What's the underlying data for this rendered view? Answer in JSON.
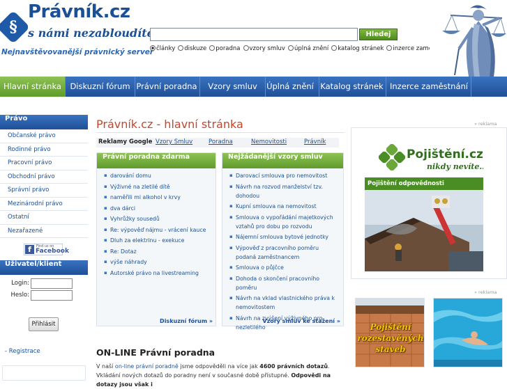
{
  "header": {
    "logo_letter": "§",
    "site_name": "Právník.cz",
    "motto": "s námi nezabloudíte...",
    "subtitle": "Nejnavštěvovanější právnický server"
  },
  "search": {
    "value": "",
    "button_label": "Hledej",
    "options": [
      "články",
      "diskuze",
      "poradna",
      "vzory smluv",
      "úplná znění",
      "katalog stránek",
      "inzerce zaměstnání"
    ],
    "selected": "články"
  },
  "nav": {
    "tabs": [
      "Hlavní stránka",
      "Diskuzní fórum",
      "Právní poradna",
      "Vzory smluv",
      "Úplná znění",
      "Katalog stránek",
      "Inzerce zaměstnání"
    ],
    "active": "Hlavní stránka"
  },
  "sidebar": {
    "law_heading": "Právo",
    "law_items": [
      "Občanské právo",
      "Rodinné právo",
      "Pracovní právo",
      "Obchodní právo",
      "Správní právo",
      "Mezinárodní právo",
      "Ostatní",
      "Nezařazené"
    ],
    "facebook_small": "Find us on",
    "facebook_big": "Facebook",
    "login_heading": "Uživatel/klient",
    "login_label": "Login:",
    "password_label": "Heslo:",
    "login_button": "Přihlásit",
    "register_link": "Registrace"
  },
  "main": {
    "title": "Právník.cz - hlavní stránka",
    "ads_label": "Reklamy Google",
    "ad_links": [
      "Vzory Smluv",
      "Poradna",
      "Nemovitosti",
      "Právník"
    ],
    "left_column": {
      "heading": "Právní poradna zdarma",
      "items": [
        "darování domu",
        "Výživné na zletilé dítě",
        "naměřili mi alkohol v krvy",
        "dva dárci",
        "Vyhrůžky sousedů",
        "Re: výpověď nájmu - vrácení kauce",
        "Dluh za elektrinu - exekuce",
        "Re: Dotaz",
        "výše náhrady",
        "Autorské právo na livestreaming"
      ],
      "more": "Diskuzní fórum »"
    },
    "right_column": {
      "heading": "Nejžádanější vzory smluv",
      "items": [
        "Darovací smlouva pro nemovitost",
        "Návrh na rozvod manželství tzv. dohodou",
        "Kupní smlouva na nemovitost",
        "Smlouva o vypořádání majetkových vztahů pro dobu po rozvodu",
        "Nájemní smlouva bytové jednotky",
        "Výpověď z pracovního poměru podaná zaměstnancem",
        "Smlouva o půjčce",
        "Dohoda o skončení pracovního poměru",
        "Návrh na vklad vlastnického práva k nemovitostem",
        "Návrh na zvýšení výživného pro nezletilého"
      ],
      "more": "Vzory smluv ke stažení »"
    },
    "online_heading": "ON-LINE Právní poradna",
    "online_text": {
      "p1": "V naší ",
      "link": "on-line právní poradně",
      "p2": " jsme odpověděli na více jak ",
      "count": "4600 právních dotazů",
      "p3": ". Vkládání nových dotazů do poradny není v současné době přístupné. ",
      "bold_end": "Odpovědi na dotazy jsou však i"
    }
  },
  "right": {
    "ad_label_top": "« reklama",
    "ad_title": "Pojištění.cz",
    "ad_tagline": "nikdy nevíte...",
    "ad_strip": "Pojištění odpovědnosti",
    "ad_label_bottom": "« reklama",
    "house_ad_text": "Pojištění rozestavěných staveb"
  },
  "colors": {
    "brand_blue": "#1f4f97",
    "accent_green": "#5f9b2b",
    "title_red": "#c8442a"
  }
}
